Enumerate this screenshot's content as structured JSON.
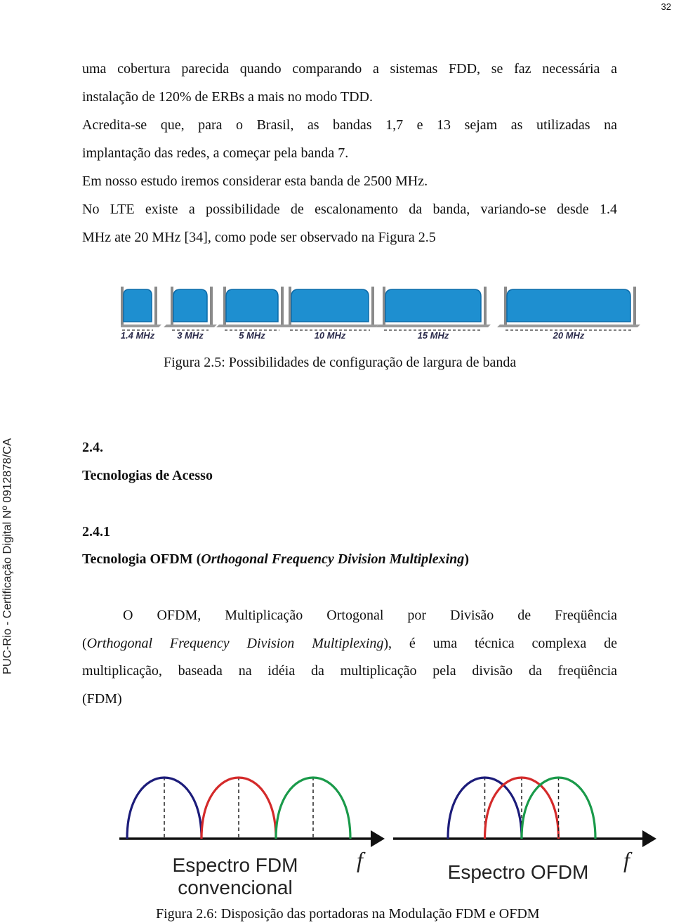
{
  "page_number": "32",
  "side_stamp": "PUC-Rio - Certificação Digital Nº 0912878/CA",
  "paragraphs": {
    "p1_line1": "uma cobertura parecida quando comparando a sistemas FDD, se faz necessária a",
    "p1_line2": "instalação de 120% de ERBs a mais no modo TDD.",
    "p2_line1": "Acredita-se que, para o Brasil, as bandas 1,7 e 13 sejam as utilizadas na",
    "p2_line2": "implantação das redes, a começar pela banda 7.",
    "p3_line1": "Em nosso estudo iremos considerar esta banda de 2500 MHz.",
    "p4_line1": "No LTE existe a possibilidade de escalonamento da banda, variando-se desde 1.4",
    "p4_line2": "MHz ate 20 MHz [34], como pode ser observado na Figura 2.5"
  },
  "figure_2_5": {
    "caption": "Figura 2.5: Possibilidades de configuração de largura de banda",
    "bands": [
      {
        "label": "1.4 MHz",
        "mhz": 1.4
      },
      {
        "label": "3 MHz",
        "mhz": 3
      },
      {
        "label": "5 MHz",
        "mhz": 5
      },
      {
        "label": "10 MHz",
        "mhz": 10
      },
      {
        "label": "15 MHz",
        "mhz": 15
      },
      {
        "label": "20 MHz",
        "mhz": 20
      }
    ],
    "fill_color": "#1e8fd0",
    "edge_color": "#0a6aa8"
  },
  "section_2_4": {
    "number": "2.4.",
    "title": "Tecnologias de Acesso"
  },
  "section_2_4_1": {
    "number": "2.4.1",
    "title_prefix": "Tecnologia OFDM (",
    "title_italic": "Orthogonal Frequency Division Multiplexing",
    "title_suffix": ")"
  },
  "ofdm_paragraph": {
    "line1": "O OFDM, Multiplicação Ortogonal por Divisão de Freqüência",
    "line2_prefix": "(",
    "line2_italic": "Orthogonal Frequency Division Multiplexing",
    "line2_suffix": "), é uma técnica complexa de",
    "line3": "multiplicação, baseada na idéia da multiplicação pela divisão da freqüência",
    "line4": "(FDM)"
  },
  "figure_2_6": {
    "caption": "Figura 2.6: Disposição das portadoras na Modulação FDM e OFDM",
    "fdm": {
      "label_line1": "Espectro FDM",
      "label_line2": "convencional",
      "axis_symbol": "f",
      "carriers": [
        {
          "name": "carrier-1",
          "color": "#1c1c7a",
          "start": 0,
          "end": 1
        },
        {
          "name": "carrier-2",
          "color": "#d42a2a",
          "start": 1,
          "end": 2
        },
        {
          "name": "carrier-3",
          "color": "#1a9a4a",
          "start": 2,
          "end": 3
        }
      ]
    },
    "ofdm": {
      "label": "Espectro OFDM",
      "axis_symbol": "f",
      "carriers": [
        {
          "name": "carrier-1",
          "color": "#1c1c7a",
          "start": 0,
          "end": 1
        },
        {
          "name": "carrier-2",
          "color": "#d42a2a",
          "start": 0.5,
          "end": 1.5
        },
        {
          "name": "carrier-3",
          "color": "#1a9a4a",
          "start": 1,
          "end": 2
        }
      ]
    }
  }
}
